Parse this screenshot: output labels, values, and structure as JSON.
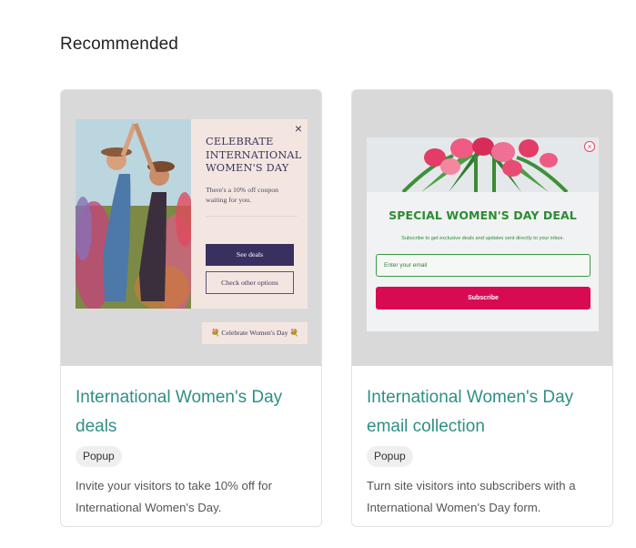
{
  "section": {
    "title": "Recommended"
  },
  "cards": [
    {
      "title": "International Women's Day deals",
      "badge": "Popup",
      "description": "Invite your visitors to take 10% off for International Women's Day.",
      "preview": {
        "close": "×",
        "heading": "CELEBRATE INTERNATIONAL WOMEN'S DAY",
        "subtext": "There's a 10% off coupon waiting for you.",
        "primary_button": "See deals",
        "secondary_button": "Check other options",
        "teaser": "💐 Celebrate Women's Day 💐"
      }
    },
    {
      "title": "International Women's Day email collection",
      "badge": "Popup",
      "description": "Turn site visitors into subscribers with a International Women's Day form.",
      "preview": {
        "close": "×",
        "heading": "SPECIAL WOMEN'S DAY DEAL",
        "subtext": "Subscribe to get exclusive deals and updates sent directly to your inbox.",
        "input_placeholder": "Enter your email",
        "button": "Subscribe"
      }
    }
  ],
  "colors": {
    "title_accent": "#2f8f85",
    "popup1_primary": "#3a3060",
    "popup2_heading": "#2d8c33",
    "popup2_button": "#d80b52"
  }
}
